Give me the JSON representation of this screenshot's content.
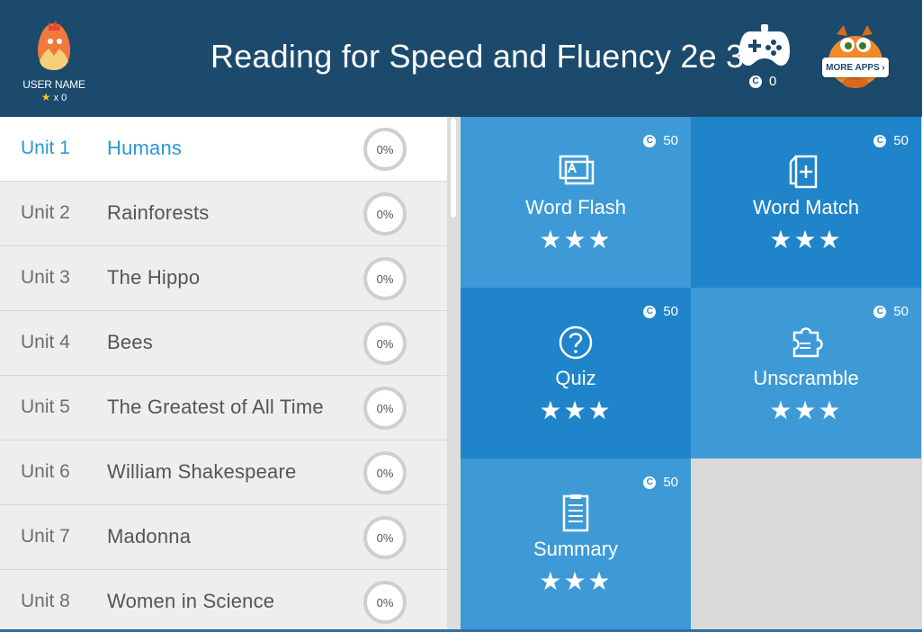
{
  "header": {
    "title": "Reading for Speed and Fluency 2e 3",
    "user_name": "USER NAME",
    "user_stars": "x 0",
    "coins": "0",
    "more_apps_label": "MORE APPS ›"
  },
  "units": [
    {
      "num": "Unit 1",
      "name": "Humans",
      "progress": "0%",
      "active": true
    },
    {
      "num": "Unit 2",
      "name": "Rainforests",
      "progress": "0%"
    },
    {
      "num": "Unit 3",
      "name": "The Hippo",
      "progress": "0%"
    },
    {
      "num": "Unit 4",
      "name": "Bees",
      "progress": "0%"
    },
    {
      "num": "Unit 5",
      "name": "The Greatest of All Time",
      "progress": "0%"
    },
    {
      "num": "Unit 6",
      "name": "William Shakespeare",
      "progress": "0%"
    },
    {
      "num": "Unit 7",
      "name": "Madonna",
      "progress": "0%"
    },
    {
      "num": "Unit 8",
      "name": "Women in Science",
      "progress": "0%"
    }
  ],
  "activities": [
    {
      "label": "Word Flash",
      "coins": "50",
      "stars": "★★★",
      "icon": "flashcard-icon"
    },
    {
      "label": "Word Match",
      "coins": "50",
      "stars": "★★★",
      "icon": "card-plus-icon"
    },
    {
      "label": "Quiz",
      "coins": "50",
      "stars": "★★★",
      "icon": "question-icon"
    },
    {
      "label": "Unscramble",
      "coins": "50",
      "stars": "★★★",
      "icon": "puzzle-icon"
    },
    {
      "label": "Summary",
      "coins": "50",
      "stars": "★★★",
      "icon": "document-icon"
    }
  ],
  "coin_symbol": "C",
  "colors": {
    "header_bg": "#1b4a6d",
    "active_unit": "#2b97d6",
    "tile_light": "#3d9ad6",
    "tile_dark": "#1f84c9"
  }
}
